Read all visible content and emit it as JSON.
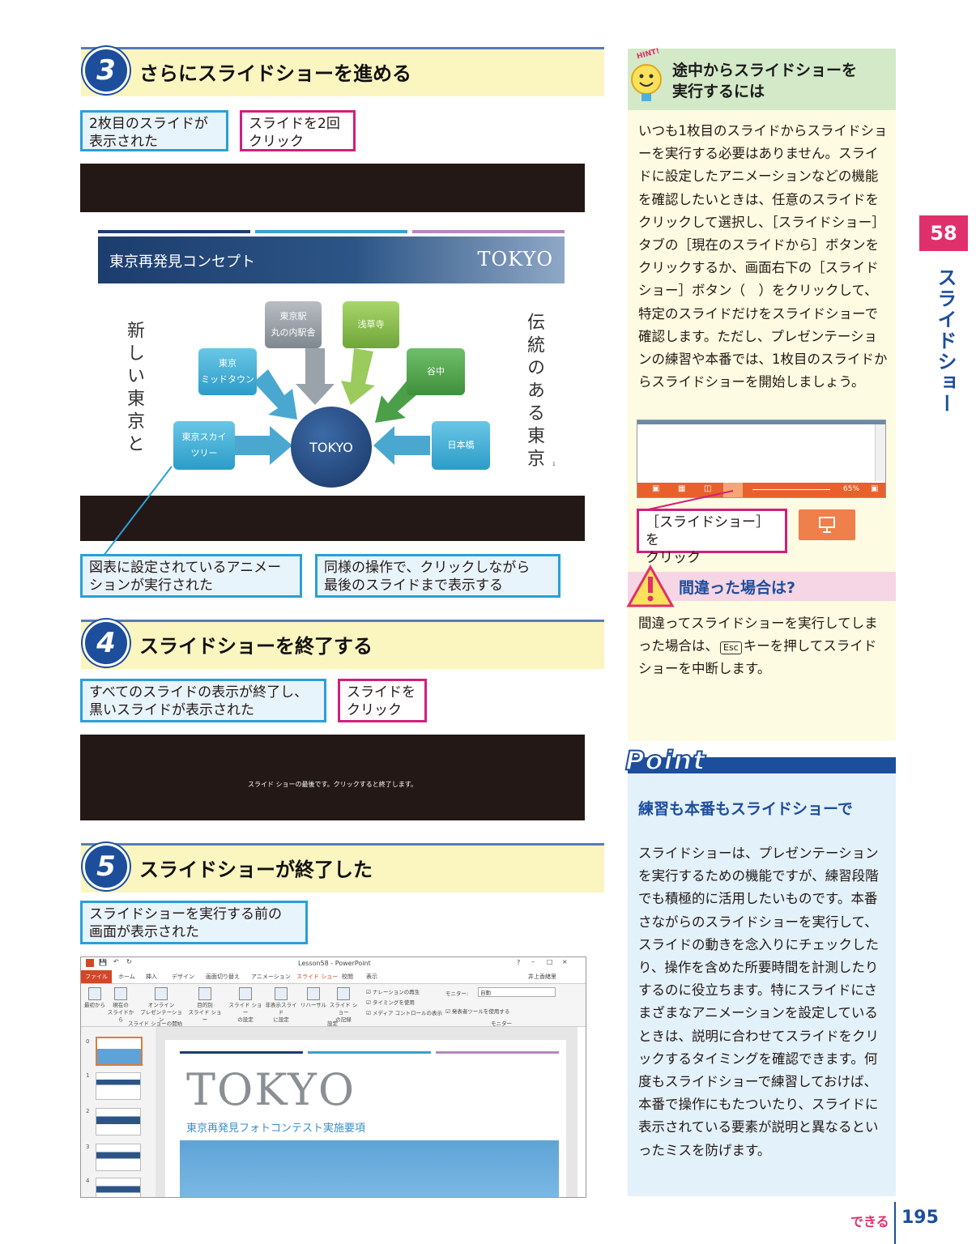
{
  "steps": [
    {
      "num": "3",
      "title": "さらにスライドショーを進める"
    },
    {
      "num": "4",
      "title": "スライドショーを終了する"
    },
    {
      "num": "5",
      "title": "スライドショーが終了した"
    }
  ],
  "callouts": {
    "s3_a": "2枚目のスライドが\n表示された",
    "s3_b": "スライドを2回\nクリック",
    "s3_c": "図表に設定されているアニメー\nションが実行された",
    "s3_d": "同様の操作で、クリックしながら\n最後のスライドまで表示する",
    "s4_a": "すべてのスライドの表示が終了し、\n黒いスライドが表示された",
    "s4_b": "スライドを\nクリック",
    "s5_a": "スライドショーを実行する前の\n画面が表示された"
  },
  "slide": {
    "title_jp": "東京再発見コンセプト",
    "title_en": "TOKYO",
    "left_vertical": "新しい東京と",
    "right_vertical": "伝統のある東京",
    "center": "TOKYO",
    "nodes": [
      "東京駅\n丸の内駅舎",
      "浅草寺",
      "東京\nミッドタウン",
      "谷中",
      "東京スカイ\nツリー",
      "日本橋"
    ],
    "page_no": "1"
  },
  "end_slide_msg": "スライド ショーの最後です。クリックすると終了します。",
  "ppt": {
    "window_title": "Lesson58 - PowerPoint",
    "user": "井上香緒里",
    "file_tab": "ファイル",
    "tabs": [
      "ホーム",
      "挿入",
      "デザイン",
      "画面切り替え",
      "アニメーション",
      "スライド ショー",
      "校閲",
      "表示"
    ],
    "ribbon_buttons": [
      "最初から",
      "現在の\nスライドから",
      "オンライン\nプレゼンテーション",
      "目的別\nスライド ショー",
      "スライド ショー\nの設定",
      "非表示スライド\nに設定",
      "リハーサル",
      "スライド ショー\nの記録"
    ],
    "checkboxes": [
      "ナレーションの再生",
      "タイミングを使用",
      "メディア コントロールの表示"
    ],
    "monitor_label": "モニター:",
    "monitor_value": "自動",
    "presenter": "発表者ツールを使用する",
    "groups": [
      "スライド ショーの開始",
      "設定",
      "モニター"
    ],
    "thumb_numbers": [
      "0",
      "1",
      "2",
      "3",
      "4"
    ],
    "slide_title": "TOKYO",
    "slide_subtitle": "東京再発見フォトコンテスト実施要項"
  },
  "hint": {
    "badge": "HINT!",
    "title": "途中からスライドショーを\n実行するには",
    "body": "いつも1枚目のスライドからスライドショーを実行する必要はありません。スライドに設定したアニメーションなどの機能を確認したいときは、任意のスライドをクリックして選択し、［スライドショー］タブの［現在のスライドから］ボタンをクリックするか、画面右下の［スライドショー］ボタン（　）をクリックして、特定のスライドだけをスライドショーで確認します。ただし、プレゼンテーションの練習や本番では、1枚目のスライドからスライドショーを開始しましょう。",
    "zoom": "65%",
    "callout": "［スライドショー］を\nクリック"
  },
  "warning": {
    "title": "間違った場合は?",
    "body_1": "間違ってスライドショーを実行してしまった場合は、",
    "key": "Esc",
    "body_2": "キーを押してスライドショーを中断します。"
  },
  "point": {
    "label": "Point",
    "title": "練習も本番もスライドショーで",
    "body": "スライドショーは、プレゼンテーションを実行するための機能ですが、練習段階でも積極的に活用したいものです。本番さながらのスライドショーを実行して、スライドの動きを念入りにチェックしたり、操作を含めた所要時間を計測したりするのに役立ちます。特にスライドにさまざまなアニメーションを設定しているときは、説明に合わせてスライドをクリックするタイミングを確認できます。何度もスライドショーで練習しておけば、本番で操作にもたついたり、スライドに表示されている要素が説明と異なるといったミスを防げます。"
  },
  "side": {
    "chapter": "58",
    "label": "スライドショー"
  },
  "footer": {
    "brand": "できる",
    "page": "195"
  },
  "colors": {
    "accent_blue": "#1d4e9c",
    "pink": "#d21f7a",
    "cyan": "#2aa0d8",
    "step_bg": "#fbf5c0"
  }
}
